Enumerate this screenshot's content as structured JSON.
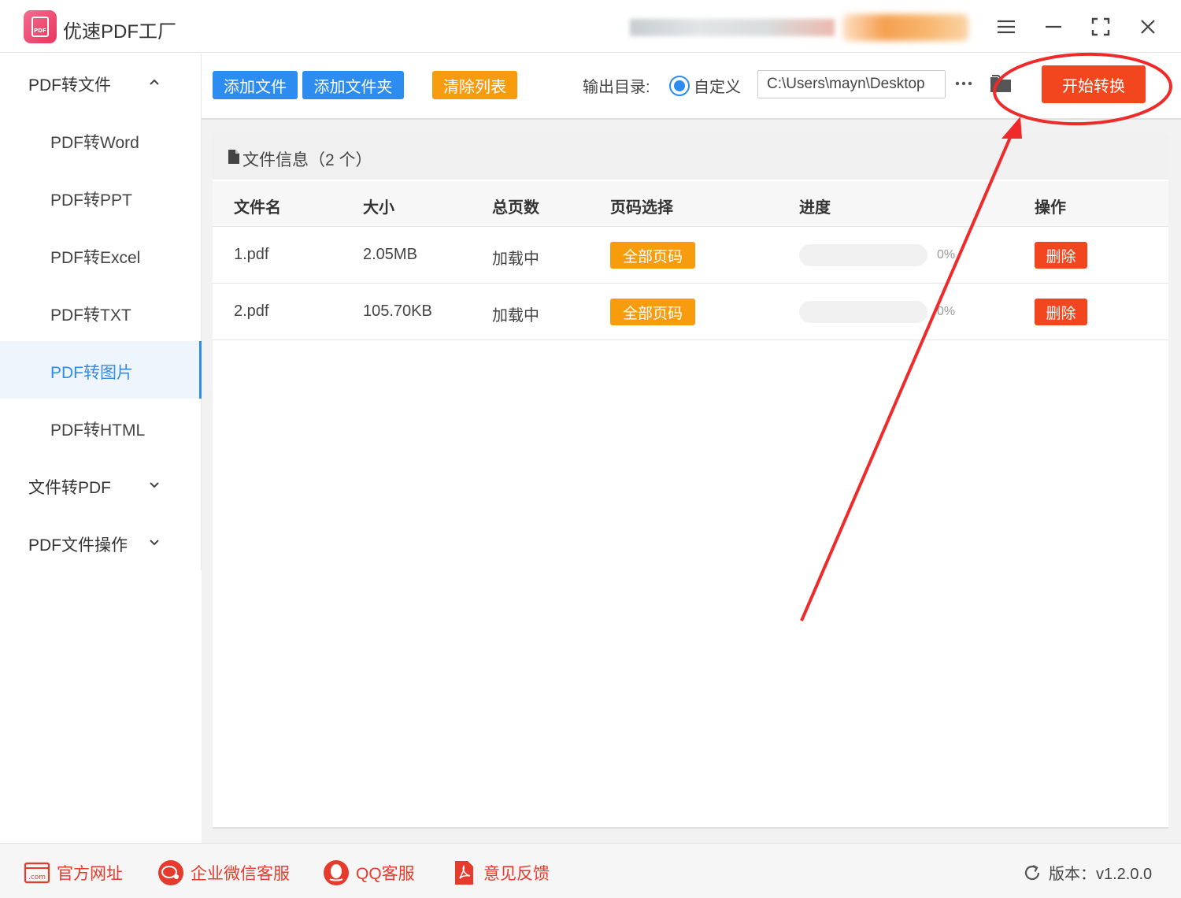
{
  "app": {
    "title": "优速PDF工厂",
    "logo_text": "PDF"
  },
  "window_controls": {
    "menu_icon": "hamburger-menu-icon",
    "minimize_icon": "minimize-icon",
    "maximize_icon": "maximize-icon",
    "close_icon": "close-icon"
  },
  "sidebar": {
    "groups": [
      {
        "label": "PDF转文件",
        "expanded": true
      },
      {
        "label": "文件转PDF",
        "expanded": false
      },
      {
        "label": "PDF文件操作",
        "expanded": false
      }
    ],
    "items": [
      {
        "label": "PDF转Word",
        "active": false
      },
      {
        "label": "PDF转PPT",
        "active": false
      },
      {
        "label": "PDF转Excel",
        "active": false
      },
      {
        "label": "PDF转TXT",
        "active": false
      },
      {
        "label": "PDF转图片",
        "active": true
      },
      {
        "label": "PDF转HTML",
        "active": false
      }
    ]
  },
  "toolbar": {
    "add_file": "添加文件",
    "add_folder": "添加文件夹",
    "clear_list": "清除列表",
    "output_label": "输出目录:",
    "output_option": "自定义",
    "output_path": "C:\\Users\\mayn\\Desktop",
    "start": "开始转换"
  },
  "file_panel": {
    "title": "文件信息（2 个）",
    "columns": [
      "文件名",
      "大小",
      "总页数",
      "页码选择",
      "进度",
      "操作"
    ],
    "rows": [
      {
        "name": "1.pdf",
        "size": "2.05MB",
        "pages": "加载中",
        "page_select": "全部页码",
        "progress_value": 0,
        "progress": "0%",
        "action": "删除"
      },
      {
        "name": "2.pdf",
        "size": "105.70KB",
        "pages": "加载中",
        "page_select": "全部页码",
        "progress_value": 0,
        "progress": "0%",
        "action": "删除"
      }
    ]
  },
  "footer": {
    "website": "官方网址",
    "wechat": "企业微信客服",
    "qq": "QQ客服",
    "feedback": "意见反馈",
    "version": "版本：v1.2.0.0"
  },
  "colors": {
    "primary": "#2d8cf0",
    "orange": "#f79b0f",
    "danger": "#f2461e",
    "annotation": "#ee2a2a"
  }
}
